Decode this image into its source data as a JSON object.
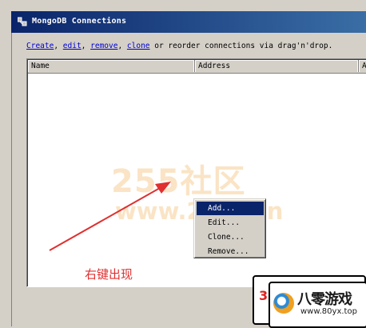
{
  "window": {
    "title": "MongoDB Connections"
  },
  "instructions": {
    "create": "Create",
    "sep1": ", ",
    "edit": "edit",
    "sep2": ", ",
    "remove": "remove",
    "sep3": ", ",
    "clone": "clone",
    "rest": " or reorder connections via drag'n'drop."
  },
  "table": {
    "columns": [
      "Name",
      "Address",
      "A"
    ],
    "rows": []
  },
  "context_menu": {
    "items": [
      "Add...",
      "Edit...",
      "Clone...",
      "Remove..."
    ],
    "selected_index": 0
  },
  "watermark": {
    "line1": "255社区",
    "line2": "www.255.xin"
  },
  "annotation": {
    "text": "右键出现",
    "color": "#e03030"
  },
  "logo": {
    "number": "3",
    "brand": "八零游戏",
    "url": "www.80yx.top"
  },
  "colors": {
    "titlebar_start": "#0a246a",
    "titlebar_end": "#3a6ea5",
    "window_bg": "#d4d0c8",
    "link": "#0000cc",
    "selection": "#0a246a"
  }
}
